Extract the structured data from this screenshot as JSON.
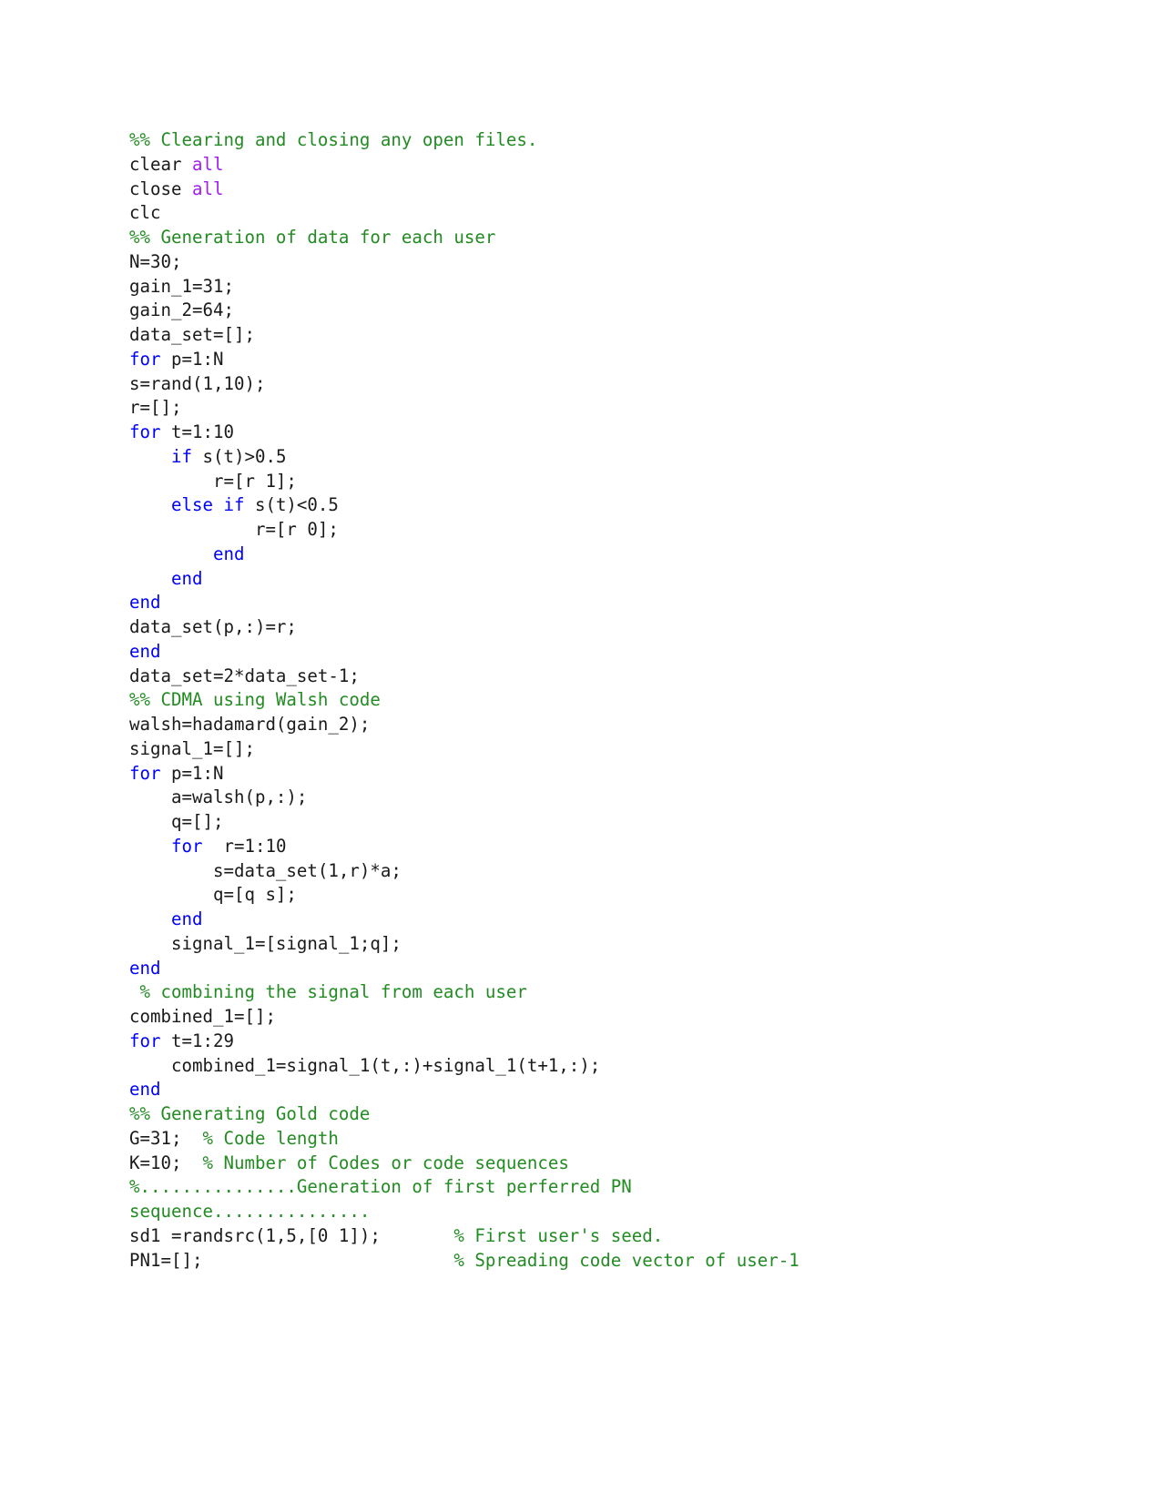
{
  "document": {
    "kind": "matlab-code-listing",
    "background_color": "#ffffff",
    "language": "MATLAB"
  },
  "syntax_colors": {
    "plain": "#1a1a1a",
    "comment": "#228b22",
    "keyword": "#0000ff",
    "special": "#a020f0"
  },
  "code": {
    "lines": [
      {
        "tokens": [
          {
            "text": "%% Clearing and closing any open files.",
            "type": "comment"
          }
        ]
      },
      {
        "tokens": [
          {
            "text": "clear ",
            "type": "plain"
          },
          {
            "text": "all",
            "type": "special"
          }
        ]
      },
      {
        "tokens": [
          {
            "text": "close ",
            "type": "plain"
          },
          {
            "text": "all",
            "type": "special"
          }
        ]
      },
      {
        "tokens": [
          {
            "text": "clc",
            "type": "plain"
          }
        ]
      },
      {
        "tokens": [
          {
            "text": "%% Generation of data for each user",
            "type": "comment"
          }
        ]
      },
      {
        "tokens": [
          {
            "text": "N=30;",
            "type": "plain"
          }
        ]
      },
      {
        "tokens": [
          {
            "text": "gain_1=31;",
            "type": "plain"
          }
        ]
      },
      {
        "tokens": [
          {
            "text": "gain_2=64;",
            "type": "plain"
          }
        ]
      },
      {
        "tokens": [
          {
            "text": "data_set=[];",
            "type": "plain"
          }
        ]
      },
      {
        "tokens": [
          {
            "text": "for",
            "type": "keyword"
          },
          {
            "text": " p=1:N",
            "type": "plain"
          }
        ]
      },
      {
        "tokens": [
          {
            "text": "s=rand(1,10);",
            "type": "plain"
          }
        ]
      },
      {
        "tokens": [
          {
            "text": "r=[];",
            "type": "plain"
          }
        ]
      },
      {
        "tokens": [
          {
            "text": "for",
            "type": "keyword"
          },
          {
            "text": " t=1:10",
            "type": "plain"
          }
        ]
      },
      {
        "tokens": [
          {
            "text": "    ",
            "type": "plain"
          },
          {
            "text": "if",
            "type": "keyword"
          },
          {
            "text": " s(t)>0.5",
            "type": "plain"
          }
        ]
      },
      {
        "tokens": [
          {
            "text": "        r=[r 1];",
            "type": "plain"
          }
        ]
      },
      {
        "tokens": [
          {
            "text": "    ",
            "type": "plain"
          },
          {
            "text": "else if",
            "type": "keyword"
          },
          {
            "text": " s(t)<0.5",
            "type": "plain"
          }
        ]
      },
      {
        "tokens": [
          {
            "text": "            r=[r 0];",
            "type": "plain"
          }
        ]
      },
      {
        "tokens": [
          {
            "text": "        ",
            "type": "plain"
          },
          {
            "text": "end",
            "type": "keyword"
          }
        ]
      },
      {
        "tokens": [
          {
            "text": "    ",
            "type": "plain"
          },
          {
            "text": "end",
            "type": "keyword"
          }
        ]
      },
      {
        "tokens": [
          {
            "text": "end",
            "type": "keyword"
          }
        ]
      },
      {
        "tokens": [
          {
            "text": "data_set(p,:)=r;",
            "type": "plain"
          }
        ]
      },
      {
        "tokens": [
          {
            "text": "end",
            "type": "keyword"
          }
        ]
      },
      {
        "tokens": [
          {
            "text": "data_set=2*data_set-1;",
            "type": "plain"
          }
        ]
      },
      {
        "tokens": [
          {
            "text": "%% CDMA using Walsh code",
            "type": "comment"
          }
        ]
      },
      {
        "tokens": [
          {
            "text": "walsh=hadamard(gain_2);",
            "type": "plain"
          }
        ]
      },
      {
        "tokens": [
          {
            "text": "signal_1=[];",
            "type": "plain"
          }
        ]
      },
      {
        "tokens": [
          {
            "text": "for",
            "type": "keyword"
          },
          {
            "text": " p=1:N",
            "type": "plain"
          }
        ]
      },
      {
        "tokens": [
          {
            "text": "    a=walsh(p,:);",
            "type": "plain"
          }
        ]
      },
      {
        "tokens": [
          {
            "text": "    q=[];",
            "type": "plain"
          }
        ]
      },
      {
        "tokens": [
          {
            "text": "    ",
            "type": "plain"
          },
          {
            "text": "for",
            "type": "keyword"
          },
          {
            "text": "  r=1:10",
            "type": "plain"
          }
        ]
      },
      {
        "tokens": [
          {
            "text": "        s=data_set(1,r)*a;",
            "type": "plain"
          }
        ]
      },
      {
        "tokens": [
          {
            "text": "        q=[q s];",
            "type": "plain"
          }
        ]
      },
      {
        "tokens": [
          {
            "text": "    ",
            "type": "plain"
          },
          {
            "text": "end",
            "type": "keyword"
          }
        ]
      },
      {
        "tokens": [
          {
            "text": "    signal_1=[signal_1;q];",
            "type": "plain"
          }
        ]
      },
      {
        "tokens": [
          {
            "text": "end",
            "type": "keyword"
          }
        ]
      },
      {
        "tokens": [
          {
            "text": " % combining the signal from each user",
            "type": "comment"
          }
        ]
      },
      {
        "tokens": [
          {
            "text": "combined_1=[];",
            "type": "plain"
          }
        ]
      },
      {
        "tokens": [
          {
            "text": "for",
            "type": "keyword"
          },
          {
            "text": " t=1:29",
            "type": "plain"
          }
        ]
      },
      {
        "tokens": [
          {
            "text": "    combined_1=signal_1(t,:)+signal_1(t+1,:);",
            "type": "plain"
          }
        ]
      },
      {
        "tokens": [
          {
            "text": "end",
            "type": "keyword"
          }
        ]
      },
      {
        "tokens": [
          {
            "text": "%% Generating Gold code",
            "type": "comment"
          }
        ]
      },
      {
        "tokens": [
          {
            "text": "G=31;",
            "type": "plain"
          },
          {
            "text": "  % Code length",
            "type": "comment"
          }
        ]
      },
      {
        "tokens": [
          {
            "text": "K=10;",
            "type": "plain"
          },
          {
            "text": "  % Number of Codes or code sequences",
            "type": "comment"
          }
        ]
      },
      {
        "tokens": [
          {
            "text": "%...............Generation of first perferred PN",
            "type": "comment"
          }
        ]
      },
      {
        "tokens": [
          {
            "text": "sequence...............",
            "type": "comment"
          }
        ]
      },
      {
        "tokens": [
          {
            "text": "sd1 =randsrc(1,5,[0 1]);",
            "type": "plain"
          },
          {
            "text": "       % First user's seed.",
            "type": "comment"
          }
        ]
      },
      {
        "tokens": [
          {
            "text": "PN1=[];",
            "type": "plain"
          },
          {
            "text": "                        % Spreading code vector of user-1",
            "type": "comment"
          }
        ]
      }
    ]
  }
}
